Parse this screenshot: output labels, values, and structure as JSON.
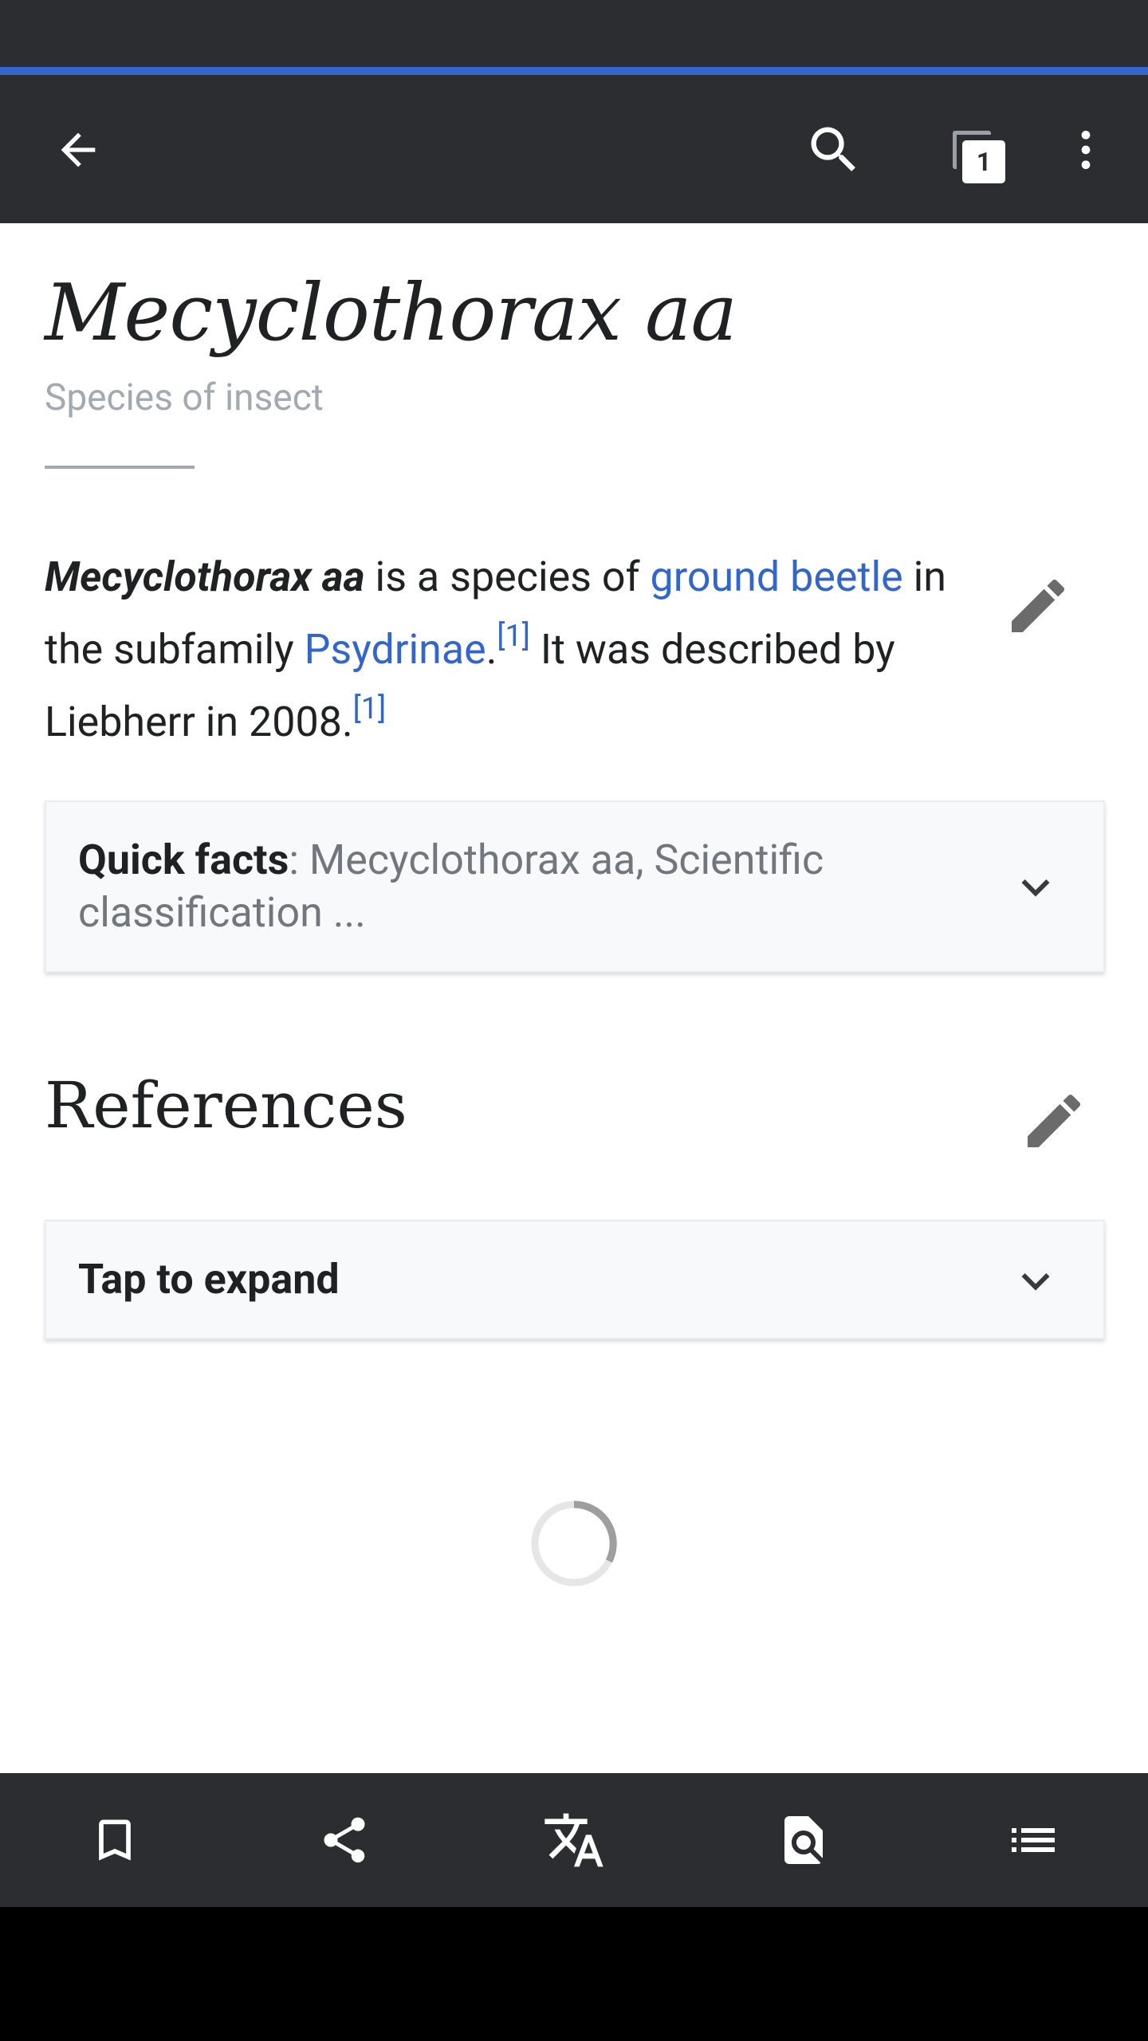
{
  "article": {
    "title": "Mecyclothorax aa",
    "description": "Species of insect",
    "intro": {
      "lead": "Mecyclothorax aa",
      "text1": " is a species of ",
      "link1": "ground beetle",
      "text2": " in the subfamily ",
      "link2": "Psydrinae",
      "text3": ".",
      "ref1": "[1]",
      "text4": " It was described by Liebherr in 2008.",
      "ref2": "[1]"
    }
  },
  "quick_facts": {
    "label": "Quick facts",
    "summary": ": Mecyclothorax aa, Scientific classification ..."
  },
  "references": {
    "heading": "References",
    "expand_label": "Tap to expand"
  },
  "toolbar": {
    "tab_count": "1"
  },
  "colors": {
    "toolbar": "#2c2d30",
    "accent": "#3366cc",
    "text": "#202122",
    "muted": "#a2a9b1"
  },
  "icons": {
    "toolbar": [
      "back-arrow-icon",
      "search-icon",
      "tabs-icon",
      "overflow-menu-icon"
    ],
    "bottom_bar": [
      "bookmark-icon",
      "share-icon",
      "translate-icon",
      "find-in-page-icon",
      "contents-list-icon"
    ]
  }
}
